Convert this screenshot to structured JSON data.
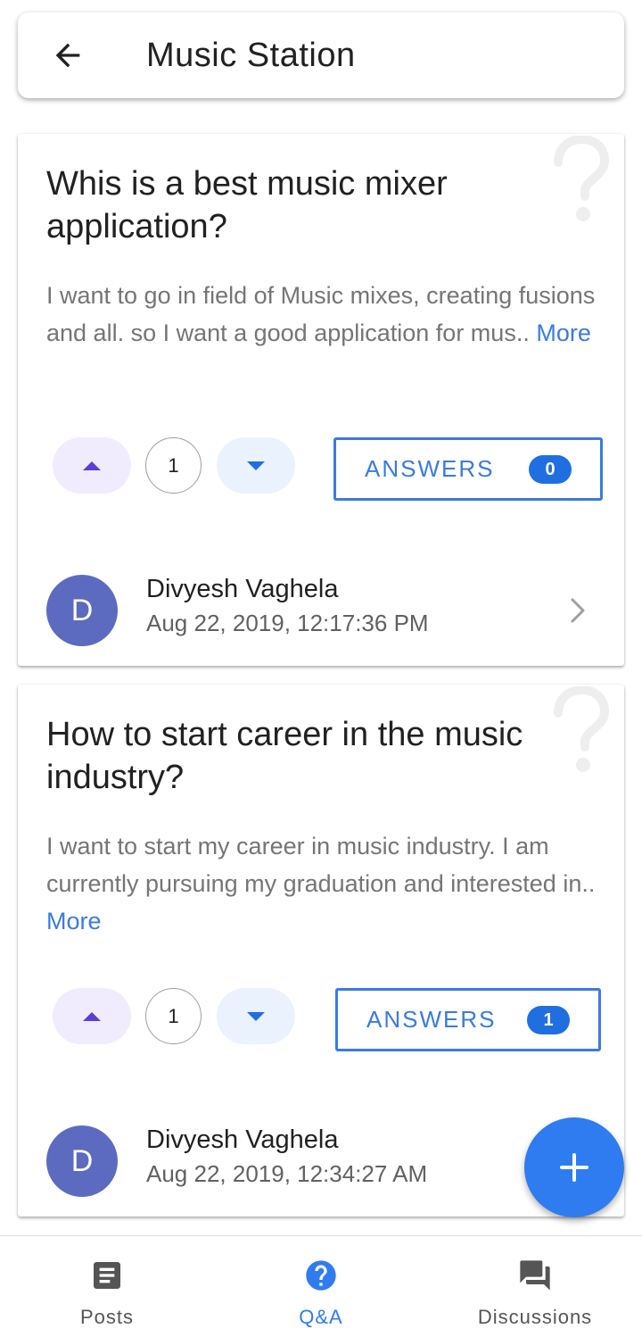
{
  "header": {
    "title": "Music Station",
    "back_icon": "arrow-back-icon"
  },
  "questions": [
    {
      "title": "Whis is a best music mixer application?",
      "body": "I want to go in field of Music mixes, creating fusions and all. so I want a good application for mus.. ",
      "more_label": "More",
      "votes": "1",
      "answers_label": "ANSWERS",
      "answers_count": "0",
      "avatar_letter": "D",
      "author": "Divyesh Vaghela",
      "date": "Aug 22, 2019, 12:17:36 PM"
    },
    {
      "title": "How to start career in the music industry?",
      "body": "I want to start my career in music industry. I am currently pursuing my graduation and interested in.. ",
      "more_label": "More",
      "votes": "1",
      "answers_label": "ANSWERS",
      "answers_count": "1",
      "avatar_letter": "D",
      "author": "Divyesh Vaghela",
      "date": "Aug 22, 2019, 12:34:27 AM"
    }
  ],
  "fab": {
    "icon": "plus-icon"
  },
  "bottom_nav": {
    "items": [
      {
        "label": "Posts",
        "icon": "posts-icon",
        "active": false
      },
      {
        "label": "Q&A",
        "icon": "help-circle-icon",
        "active": true
      },
      {
        "label": "Discussions",
        "icon": "forum-icon",
        "active": false
      }
    ]
  },
  "colors": {
    "accent": "#2e7cf0",
    "upvote_bg": "#f1ecfd",
    "downvote_bg": "#eaf2fd",
    "avatar": "#5c6bc0"
  }
}
